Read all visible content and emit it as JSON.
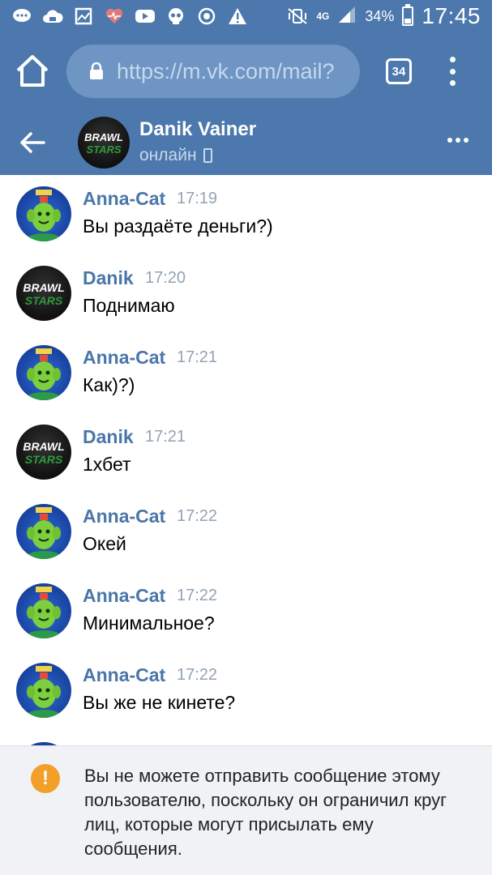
{
  "statusbar": {
    "network": "4G",
    "battery_percent": "34%",
    "time": "17:45",
    "icons": [
      "chat-icon",
      "cloud-icon",
      "image-icon",
      "heart-icon",
      "youtube-icon",
      "skull-icon",
      "sync-icon",
      "warning-icon"
    ]
  },
  "browser": {
    "url": "https://m.vk.com/mail?",
    "tab_count": "34"
  },
  "chat": {
    "contact_name": "Danik Vainer",
    "contact_status": "онлайн"
  },
  "messages": [
    {
      "author": "Anna-Cat",
      "time": "17:19",
      "text": "Вы раздаёте деньги?)",
      "avatar": "cat"
    },
    {
      "author": "Danik",
      "time": "17:20",
      "text": "Поднимаю",
      "avatar": "brawl"
    },
    {
      "author": "Anna-Cat",
      "time": "17:21",
      "text": "Как)?)",
      "avatar": "cat"
    },
    {
      "author": "Danik",
      "time": "17:21",
      "text": "1хбет",
      "avatar": "brawl"
    },
    {
      "author": "Anna-Cat",
      "time": "17:22",
      "text": "Окей",
      "avatar": "cat"
    },
    {
      "author": "Anna-Cat",
      "time": "17:22",
      "text": "Минимальное?",
      "avatar": "cat"
    },
    {
      "author": "Anna-Cat",
      "time": "17:22",
      "text": "Вы же не кинете?",
      "avatar": "cat"
    }
  ],
  "notice": {
    "text": "Вы не можете отправить сообщение этому пользователю, поскольку он ограничил круг лиц, которые могут присылать ему сообщения."
  },
  "avatar_labels": {
    "line1": "BRAWL",
    "line2": "STARS"
  },
  "colors": {
    "brand": "#4c78ad",
    "name": "#4a76a8",
    "warning": "#f3a02a"
  }
}
